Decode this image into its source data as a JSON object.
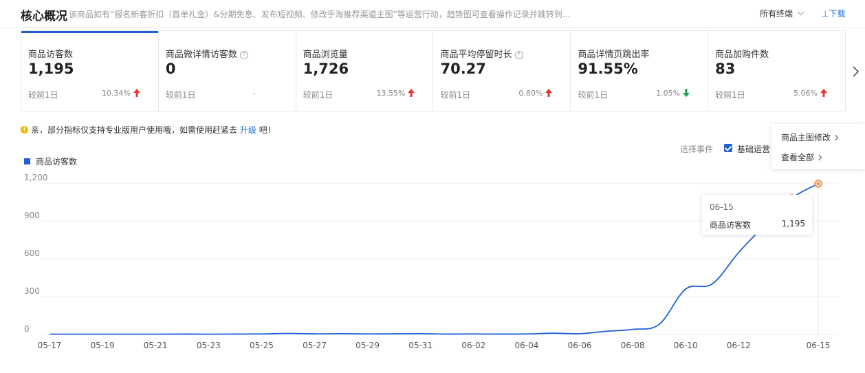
{
  "header": {
    "title": "核心概况",
    "description": "该商品如有“报名新客折扣（首单礼金）&分期免息、发布短视频、修改手淘推荐渠道主图”等运营行动，趋势图可查看操作记录并跳转到...",
    "terminal_select": "所有终端",
    "download": "下载"
  },
  "metrics": [
    {
      "label": "商品访客数",
      "value": "1,195",
      "compare": "较前1日",
      "change": "10.34%",
      "direction": "up",
      "help": false
    },
    {
      "label": "商品微详情访客数",
      "value": "0",
      "compare": "较前1日",
      "change": "-",
      "direction": "none",
      "help": true
    },
    {
      "label": "商品浏览量",
      "value": "1,726",
      "compare": "较前1日",
      "change": "13.55%",
      "direction": "up",
      "help": false
    },
    {
      "label": "商品平均停留时长",
      "value": "70.27",
      "compare": "较前1日",
      "change": "0.80%",
      "direction": "up",
      "help": true
    },
    {
      "label": "商品详情页跳出率",
      "value": "91.55%",
      "compare": "较前1日",
      "change": "1.05%",
      "direction": "down",
      "help": false
    },
    {
      "label": "商品加购件数",
      "value": "83",
      "compare": "较前1日",
      "change": "5.06%",
      "direction": "up",
      "help": false
    }
  ],
  "notice": {
    "text_before": "亲，部分指标仅支持专业版用户使用哦，如需使用赶紧去",
    "link": "升级",
    "text_after": "吧！"
  },
  "events": {
    "label": "选择事件",
    "checkbox_label": "基础运营",
    "checked": true
  },
  "dropdown": {
    "items": [
      "商品主图修改",
      "查看全部"
    ]
  },
  "tooltip": {
    "date": "06-15",
    "series": "商品访客数",
    "value": "1,195"
  },
  "colors": {
    "accent": "#1f5fd6",
    "up": "#e8342e",
    "down": "#1aa64a",
    "marker": "#f08a3c"
  },
  "chart_data": {
    "type": "line",
    "legend_position": "top-left",
    "grid": true,
    "ylim": [
      0,
      1200
    ],
    "yticks": [
      0,
      300,
      600,
      900,
      1200
    ],
    "ytick_labels": [
      "0",
      "300",
      "600",
      "900",
      "1,200"
    ],
    "xtick_labels": [
      "05-17",
      "05-19",
      "05-21",
      "05-23",
      "05-25",
      "05-27",
      "05-29",
      "05-31",
      "06-02",
      "06-04",
      "06-06",
      "06-08",
      "06-10",
      "06-12",
      "06-15"
    ],
    "x": [
      "05-17",
      "05-18",
      "05-19",
      "05-20",
      "05-21",
      "05-22",
      "05-23",
      "05-24",
      "05-25",
      "05-26",
      "05-27",
      "05-28",
      "05-29",
      "05-30",
      "05-31",
      "06-01",
      "06-02",
      "06-03",
      "06-04",
      "06-05",
      "06-06",
      "06-07",
      "06-08",
      "06-09",
      "06-10",
      "06-11",
      "06-12",
      "06-13",
      "06-14",
      "06-15"
    ],
    "series": [
      {
        "name": "商品访客数",
        "values": [
          2,
          2,
          2,
          2,
          2,
          3,
          2,
          3,
          4,
          8,
          5,
          6,
          4,
          5,
          6,
          3,
          4,
          3,
          4,
          10,
          6,
          25,
          40,
          80,
          360,
          400,
          650,
          870,
          1080,
          1195
        ]
      }
    ],
    "highlight_points": [
      "06-14",
      "06-15"
    ]
  }
}
